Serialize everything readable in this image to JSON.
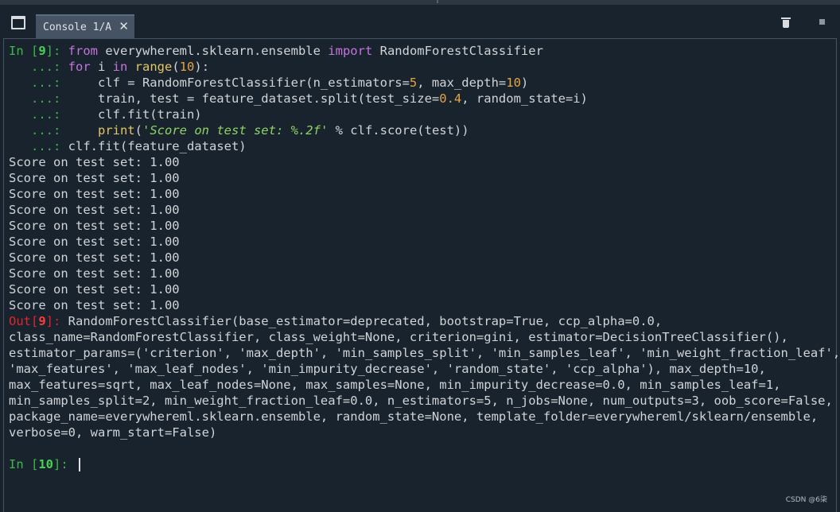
{
  "tab": {
    "label": "Console 1/A",
    "close": "✕"
  },
  "icons": {
    "window": "window-icon",
    "trash": "trash-icon",
    "stop": "stop-icon"
  },
  "input1": {
    "prompt": "In [",
    "number": "9",
    "suffix": "]: ",
    "lines": [
      [
        "from",
        " everywhereml.sklearn.ensemble ",
        "import",
        " RandomForestClassifier"
      ],
      [
        "for",
        " i ",
        "in",
        " ",
        "range",
        "(",
        "10",
        "):"
      ],
      [
        "    clf = RandomForestClassifier(n_estimators=",
        "5",
        ", max_depth=",
        "10",
        ")"
      ],
      [
        "    train, test = feature_dataset.split(test_size=",
        "0.4",
        ", random_state=i)"
      ],
      [
        "    clf.fit(train)"
      ],
      [
        "    ",
        "print",
        "(",
        "'Score on test set: %.2f'",
        " % clf.score(test))"
      ],
      [
        "clf.fit(feature_dataset)"
      ]
    ],
    "cont_prompt": "   ...: "
  },
  "stdout": [
    "Score on test set: 1.00",
    "Score on test set: 1.00",
    "Score on test set: 1.00",
    "Score on test set: 1.00",
    "Score on test set: 1.00",
    "Score on test set: 1.00",
    "Score on test set: 1.00",
    "Score on test set: 1.00",
    "Score on test set: 1.00",
    "Score on test set: 1.00"
  ],
  "output": {
    "prompt": "Out[",
    "number": "9",
    "suffix": "]: ",
    "lines": [
      "RandomForestClassifier(base_estimator=deprecated, bootstrap=True, ccp_alpha=0.0,",
      "class_name=RandomForestClassifier, class_weight=None, criterion=gini, estimator=DecisionTreeClassifier(),",
      "estimator_params=('criterion', 'max_depth', 'min_samples_split', 'min_samples_leaf', 'min_weight_fraction_leaf',",
      "'max_features', 'max_leaf_nodes', 'min_impurity_decrease', 'random_state', 'ccp_alpha'), max_depth=10,",
      "max_features=sqrt, max_leaf_nodes=None, max_samples=None, min_impurity_decrease=0.0, min_samples_leaf=1,",
      "min_samples_split=2, min_weight_fraction_leaf=0.0, n_estimators=5, n_jobs=None, num_outputs=3, oob_score=False,",
      "package_name=everywhereml.sklearn.ensemble, random_state=None, template_folder=everywhereml/sklearn/ensemble,",
      "verbose=0, warm_start=False)"
    ]
  },
  "input2": {
    "prompt": "In [",
    "number": "10",
    "suffix": "]: "
  },
  "watermark": "CSDN @6柒"
}
